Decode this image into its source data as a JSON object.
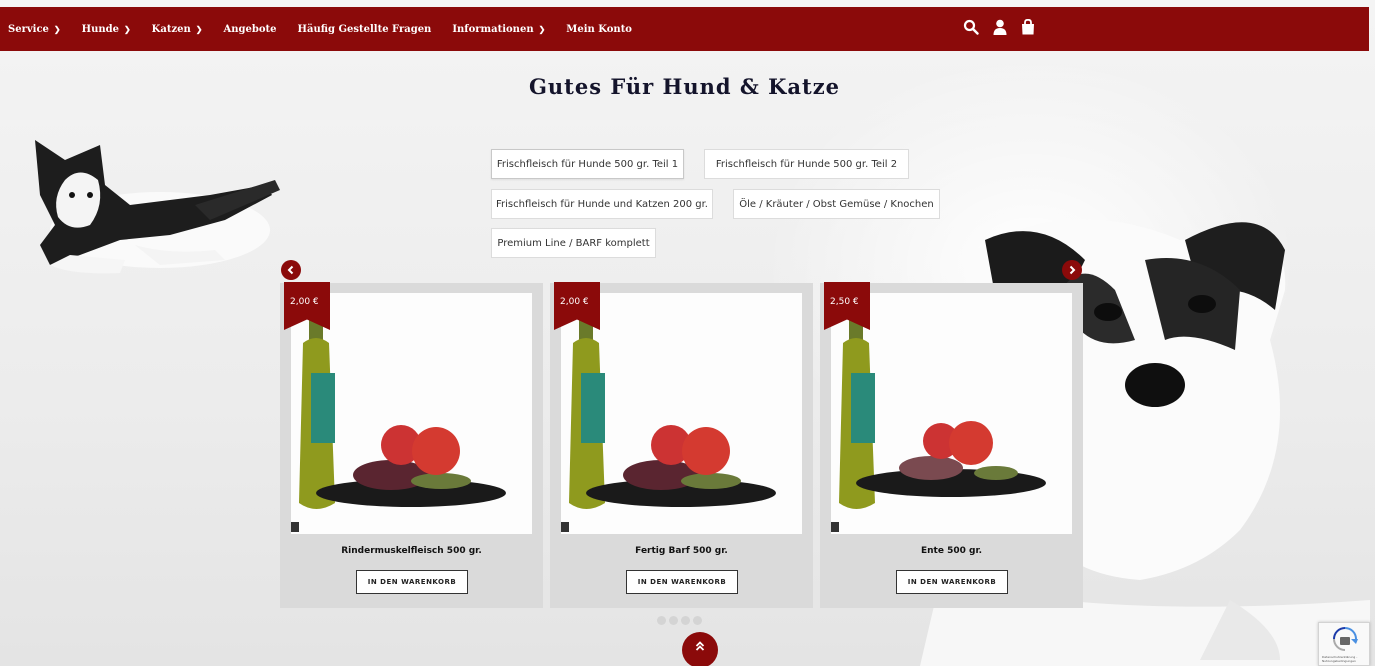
{
  "nav": {
    "items": [
      {
        "label": "Service",
        "dropdown": true
      },
      {
        "label": "Hunde",
        "dropdown": true
      },
      {
        "label": "Katzen",
        "dropdown": true
      },
      {
        "label": "Angebote",
        "dropdown": false
      },
      {
        "label": "Häufig Gestellte Fragen",
        "dropdown": false
      },
      {
        "label": "Informationen",
        "dropdown": true
      },
      {
        "label": "Mein Konto",
        "dropdown": false
      }
    ],
    "icons": [
      "search-icon",
      "user-icon",
      "shopping-bag-icon"
    ],
    "background": "#8b0a0a"
  },
  "page": {
    "title": "Gutes Für Hund & Katze"
  },
  "tabs": [
    {
      "label": "Frischfleisch für Hunde 500 gr. Teil 1",
      "active": true
    },
    {
      "label": "Frischfleisch für Hunde 500 gr. Teil 2",
      "active": false
    },
    {
      "label": "Frischfleisch für Hunde und Katzen 200 gr.",
      "active": false
    },
    {
      "label": "Öle / Kräuter / Obst Gemüse / Knochen",
      "active": false
    },
    {
      "label": "Premium Line / BARF komplett",
      "active": false
    }
  ],
  "products": [
    {
      "price": "2,00 €",
      "name": "Rindermuskelfleisch 500 gr.",
      "button": "IN DEN WARENKORB"
    },
    {
      "price": "2,00 €",
      "name": "Fertig Barf 500 gr.",
      "button": "IN DEN WARENKORB"
    },
    {
      "price": "2,50 €",
      "name": "Ente 500 gr.",
      "button": "IN DEN WARENKORB"
    }
  ],
  "carousel": {
    "prev_icon": "chevron-left-icon",
    "next_icon": "chevron-right-icon",
    "dots": 4
  },
  "scroll_top_icon": "double-chevron-up-icon",
  "recaptcha_text": "Datenschutzerklärung - Nutzungsbedingungen",
  "colors": {
    "accent": "#8b0a0a",
    "card": "#dadada"
  }
}
